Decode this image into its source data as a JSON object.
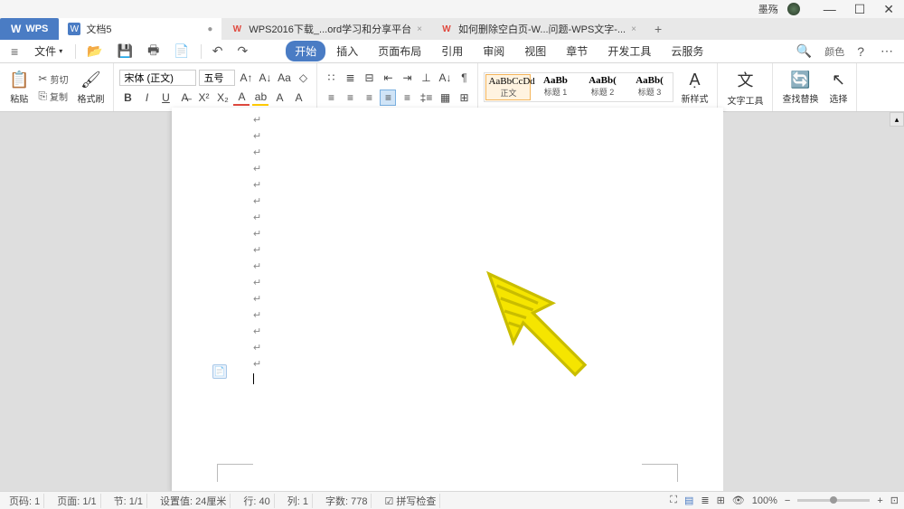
{
  "titlebar": {
    "user": "墨殇"
  },
  "tabs": {
    "app": "WPS",
    "t1": "文档5",
    "t2": "WPS2016下载_...ord学习和分享平台",
    "t3": "如何删除空白页-W...问题-WPS文字-..."
  },
  "menu": {
    "file": "文件",
    "ribbon": [
      "开始",
      "插入",
      "页面布局",
      "引用",
      "审阅",
      "视图",
      "章节",
      "开发工具",
      "云服务"
    ],
    "color_label": "颜色"
  },
  "ribbon": {
    "paste": "粘贴",
    "cut": "剪切",
    "copy": "复制",
    "formatpainter": "格式刷",
    "font_name": "宋体 (正文)",
    "font_size": "五号",
    "style_prev": [
      "AaBbCcDd",
      "AaBb",
      "AaBb(",
      "AaBb("
    ],
    "style_name": [
      "正文",
      "标题 1",
      "标题 2",
      "标题 3"
    ],
    "newstyle": "新样式",
    "texttool": "文字工具",
    "findreplace": "查找替换",
    "select": "选择"
  },
  "status": {
    "page_no": "页码: 1",
    "page": "页面: 1/1",
    "section": "节: 1/1",
    "setval": "设置值: 24厘米",
    "row": "行: 40",
    "col": "列: 1",
    "words": "字数: 778",
    "spell": "拼写检查",
    "zoom": "100%"
  }
}
